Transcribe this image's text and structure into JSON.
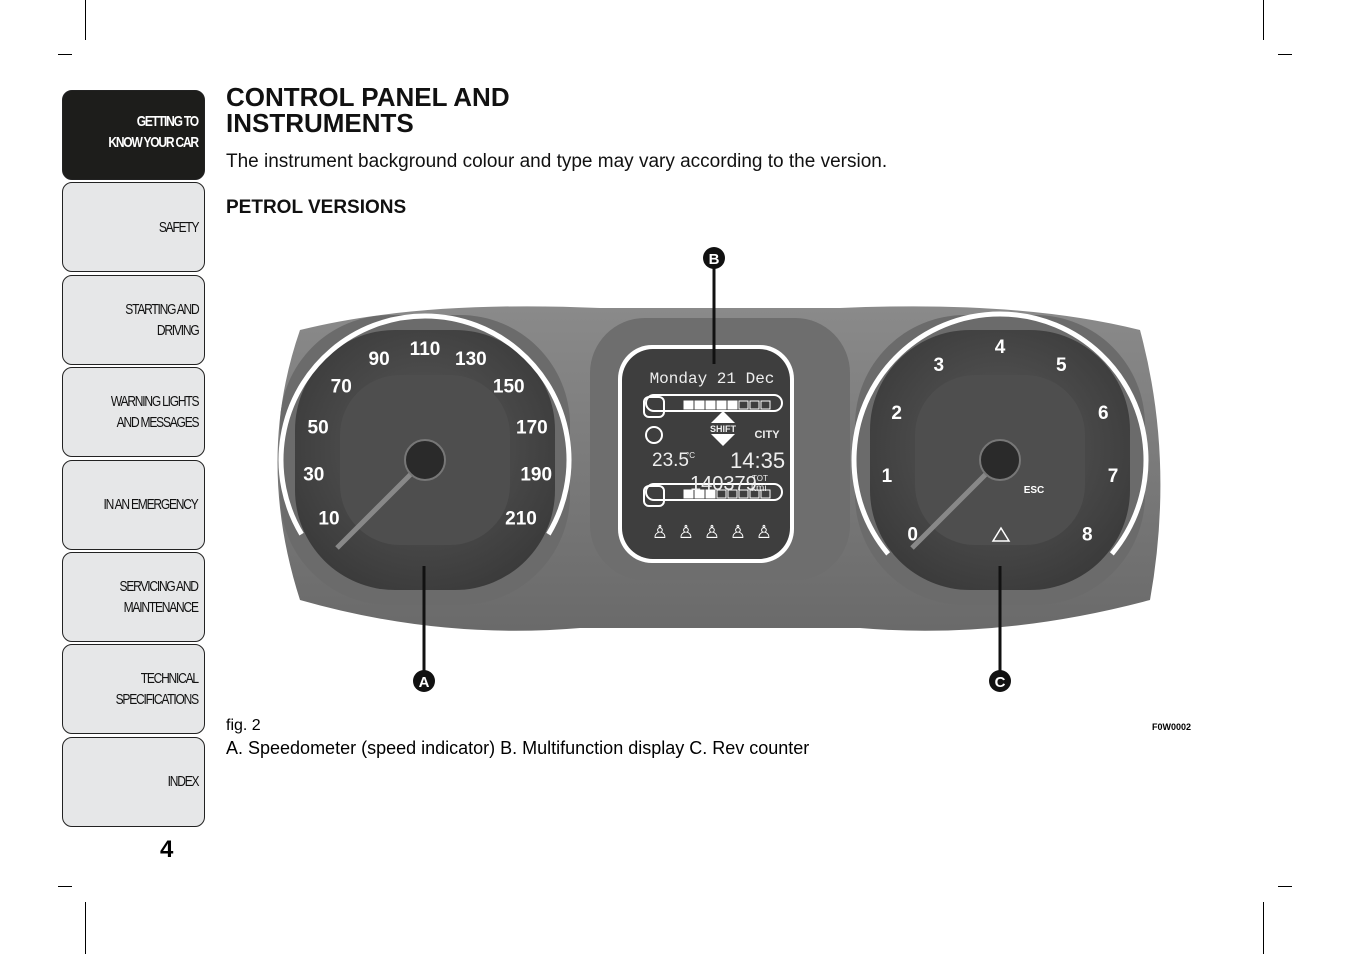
{
  "sidebar": {
    "items": [
      {
        "label": "GETTING TO\nKNOW YOUR CAR",
        "active": true
      },
      {
        "label": "SAFETY"
      },
      {
        "label": "STARTING AND\nDRIVING"
      },
      {
        "label": "WARNING LIGHTS\nAND MESSAGES"
      },
      {
        "label": "IN AN EMERGENCY"
      },
      {
        "label": "SERVICING AND\nMAINTENANCE"
      },
      {
        "label": "TECHNICAL\nSPECIFICATIONS"
      },
      {
        "label": "INDEX"
      }
    ]
  },
  "page_number": "4",
  "title": "CONTROL PANEL AND\nINSTRUMENTS",
  "subtitle": "The instrument background colour and type may vary according to the version.",
  "section": "PETROL VERSIONS",
  "figure": {
    "callouts": {
      "a": "A",
      "b": "B",
      "c": "C"
    },
    "speedometer_labels": [
      "10",
      "30",
      "50",
      "70",
      "90",
      "110",
      "130",
      "150",
      "170",
      "190",
      "210"
    ],
    "rev_labels": [
      "0",
      "1",
      "2",
      "3",
      "4",
      "5",
      "6",
      "7",
      "8"
    ],
    "display": {
      "date": "Monday 21 Dec",
      "shift": "SHIFT",
      "mode": "CITY",
      "temperature": "23.5",
      "temp_unit": "°C",
      "time": "14:35",
      "odometer": "140379",
      "odo_label": "TOT",
      "odo_unit": "kmi",
      "esc": "ESC"
    },
    "fig_label": "fig. 2",
    "code": "F0W0002",
    "caption": "A. Speedometer (speed indicator) B. Multifunction display C. Rev counter"
  }
}
